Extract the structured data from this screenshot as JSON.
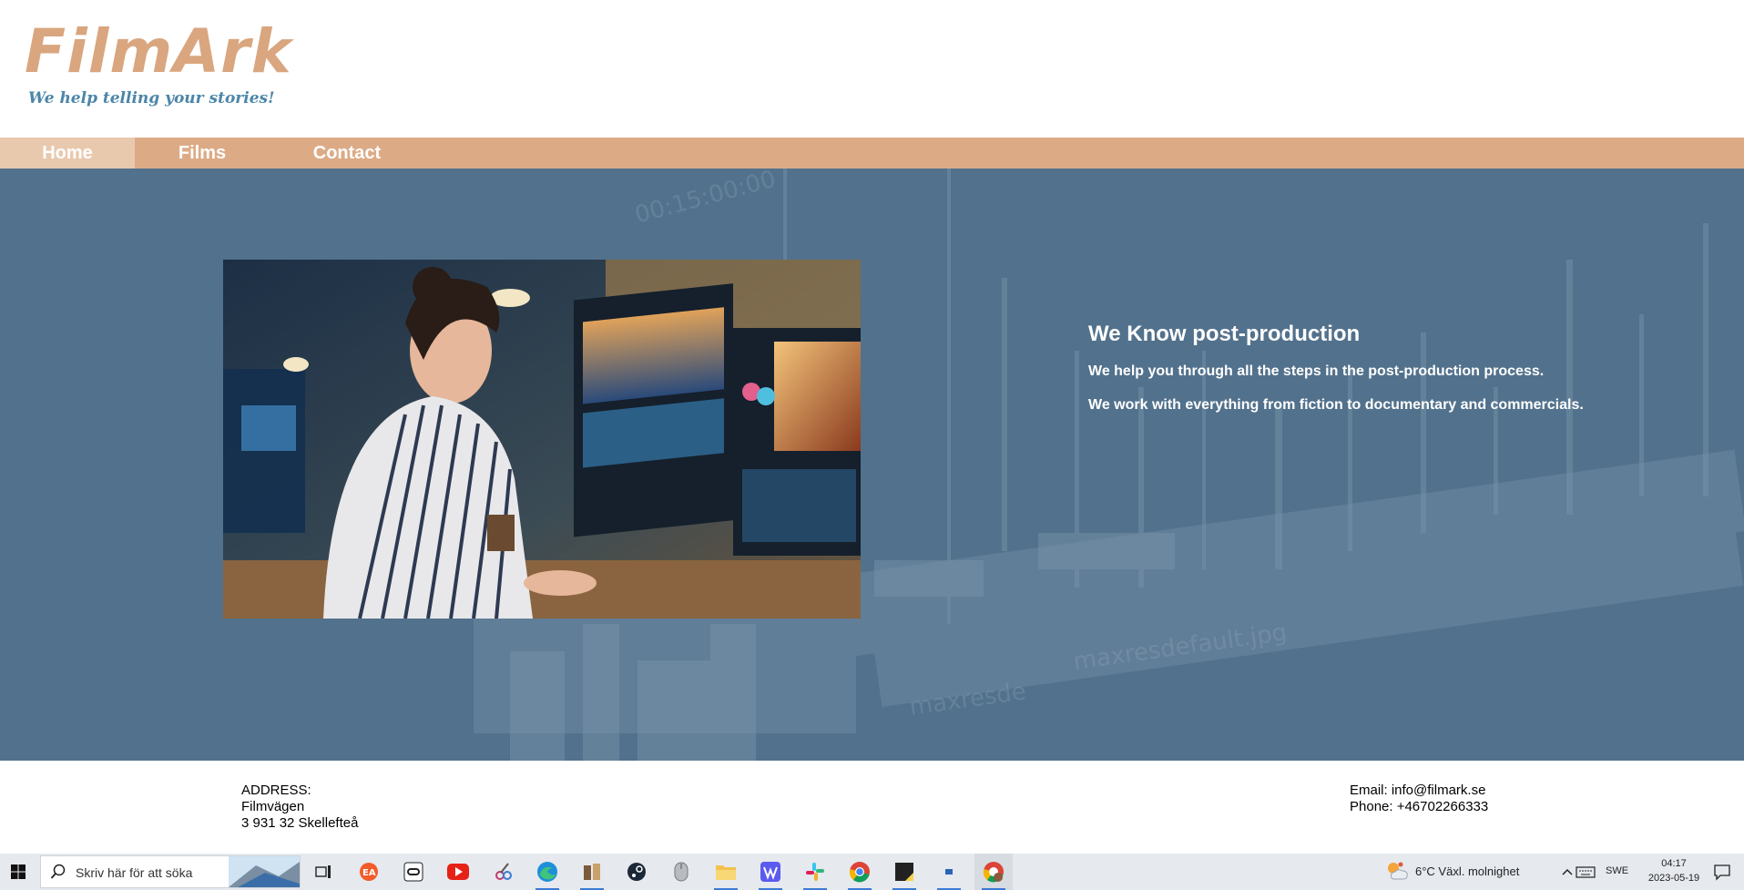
{
  "site": {
    "logo": "FilmArk",
    "tagline": "We help telling your stories!"
  },
  "nav": {
    "items": [
      {
        "label": "Home",
        "active": true
      },
      {
        "label": "Films",
        "active": false
      },
      {
        "label": "Contact",
        "active": false
      }
    ]
  },
  "hero": {
    "title": "We Know post-production",
    "lines": [
      "We help you through all the steps in the post-production process.",
      "We work with everything from fiction to documentary and commercials."
    ]
  },
  "footer": {
    "address_label": "ADDRESS:",
    "street": "Filmvägen",
    "city": "3 931 32 Skellefteå",
    "email": "Email: info@filmark.se",
    "phone": "Phone: +46702266333"
  },
  "taskbar": {
    "search_placeholder": "Skriv här för att söka",
    "weather": "6°C  Växl. molnighet",
    "language": "SWE",
    "time": "04:17",
    "date": "2023-05-19",
    "apps": [
      "task-view",
      "ea-app",
      "oculus",
      "youtube",
      "snipping-tool",
      "edge",
      "app-manager",
      "steam",
      "mouse-settings",
      "file-explorer",
      "writer",
      "slack",
      "chrome",
      "sticky-notes",
      "terminal",
      "chrome-profile"
    ]
  },
  "colors": {
    "brand": "#d9a67f",
    "nav": "#dcab86",
    "nav_active": "#e9c9ae",
    "hero_bg": "#52718c",
    "tagline": "#4b86a8"
  }
}
